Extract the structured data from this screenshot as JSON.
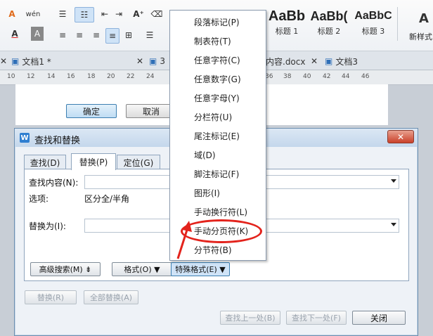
{
  "ribbon": {
    "font_icon": "wén",
    "text_color_icon": "A",
    "styles": [
      {
        "preview": "AaBb",
        "name": "标题 1"
      },
      {
        "preview": "AaBb(",
        "name": "标题 2"
      },
      {
        "preview": "AaBbC",
        "name": "标题 3"
      }
    ],
    "new_style_label": "新样式"
  },
  "tabs": [
    {
      "label": "文档1 *"
    },
    {
      "label": "3"
    },
    {
      "label": "内容.docx"
    },
    {
      "label": "文档3"
    }
  ],
  "ruler": [
    "10",
    "12",
    "14",
    "16",
    "18",
    "20",
    "22",
    "24",
    "36",
    "38",
    "40",
    "42",
    "44",
    "46"
  ],
  "background_dialog": {
    "ok_label": "确定",
    "cancel_label": "取消"
  },
  "dialog": {
    "title": "查找和替换",
    "tabs": [
      "查找(D)",
      "替换(P)",
      "定位(G)"
    ],
    "find_label": "查找内容(N):",
    "options_label": "选项:",
    "options_value": "区分全/半角",
    "replace_label": "替换为(I):",
    "advanced_button": "高级搜索(M) ⇟",
    "format_button": "格式(O) ▼",
    "special_button": "特殊格式(E) ▼",
    "replace_button": "替换(R)",
    "replace_all_button": "全部替换(A)",
    "find_prev_button": "查找上一处(B)",
    "find_next_button": "查找下一处(F)",
    "close_button": "关闭"
  },
  "menu": {
    "items": [
      "段落标记(P)",
      "制表符(T)",
      "任意字符(C)",
      "任意数字(G)",
      "任意字母(Y)",
      "分栏符(U)",
      "尾注标记(E)",
      "域(D)",
      "脚注标记(F)",
      "图形(I)",
      "手动换行符(L)",
      "手动分页符(K)",
      "分节符(B)"
    ]
  },
  "colors": {
    "annotation": "#e3231c",
    "accent": "#3c7fb1"
  }
}
